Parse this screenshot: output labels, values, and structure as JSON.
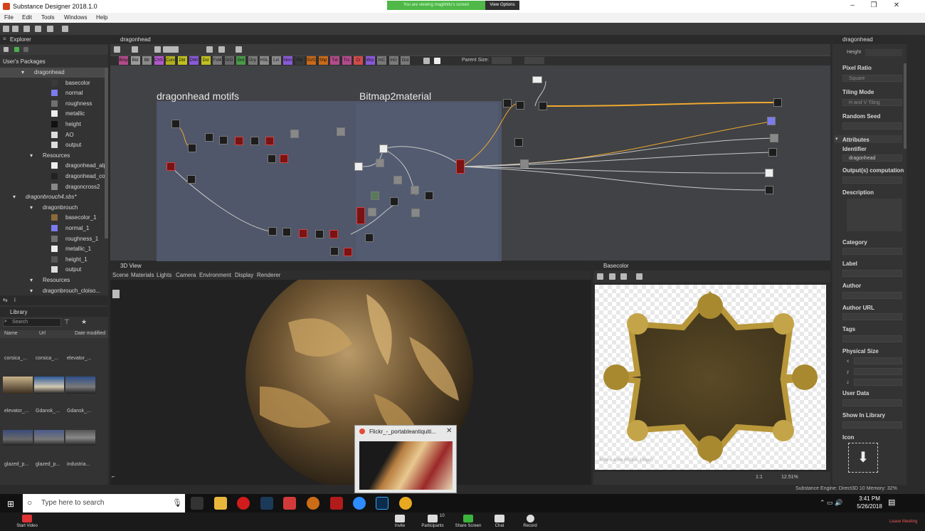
{
  "window": {
    "title": "Substance Designer 2018.1.0",
    "share_banner": "You are viewing magbhitu's screen",
    "view_options": "View Options"
  },
  "menu": [
    "File",
    "Edit",
    "Tools",
    "Windows",
    "Help"
  ],
  "explorer": {
    "title": "Explorer",
    "user_packages": "User's Packages",
    "items": [
      {
        "label": "dragonhead",
        "indent": 1,
        "swatch": "",
        "sel": true
      },
      {
        "label": "basecolor",
        "indent": 3,
        "swatch": "#3a3a3a"
      },
      {
        "label": "normal",
        "indent": 3,
        "swatch": "#7b7bee"
      },
      {
        "label": "roughness",
        "indent": 3,
        "swatch": "#707070"
      },
      {
        "label": "metallic",
        "indent": 3,
        "swatch": "#eeeeee"
      },
      {
        "label": "height",
        "indent": 3,
        "swatch": "#111111"
      },
      {
        "label": "AO",
        "indent": 3,
        "swatch": "#dddddd"
      },
      {
        "label": "output",
        "indent": 3,
        "swatch": "#dddddd"
      },
      {
        "label": "Resources",
        "indent": 2,
        "swatch": ""
      },
      {
        "label": "dragonhead_alpha...",
        "indent": 3,
        "swatch": "#eeeeee"
      },
      {
        "label": "dragonhead_color1",
        "indent": 3,
        "swatch": "#222222"
      },
      {
        "label": "dragoncross2",
        "indent": 3,
        "swatch": "#888888"
      },
      {
        "label": "dragonbrouch4.sbs*",
        "indent": 0,
        "swatch": ""
      },
      {
        "label": "dragonbrouch",
        "indent": 2,
        "swatch": ""
      },
      {
        "label": "basecolor_1",
        "indent": 3,
        "swatch": "#8a6a3a"
      },
      {
        "label": "normal_1",
        "indent": 3,
        "swatch": "#7b7bee"
      },
      {
        "label": "roughness_1",
        "indent": 3,
        "swatch": "#707070"
      },
      {
        "label": "metallic_1",
        "indent": 3,
        "swatch": "#eeeeee"
      },
      {
        "label": "height_1",
        "indent": 3,
        "swatch": "#555555"
      },
      {
        "label": "output",
        "indent": 3,
        "swatch": "#dddddd"
      },
      {
        "label": "Resources",
        "indent": 2,
        "swatch": ""
      },
      {
        "label": "dragonbrouch_cloiso...",
        "indent": 2,
        "swatch": ""
      }
    ]
  },
  "graph": {
    "title": "dragonhead",
    "frame_title": "dragonhead motifs",
    "bitmap_label": "Bitmap2material",
    "parent_size": "Parent Size:",
    "tags": [
      "Bmp",
      "Bld",
      "Blr",
      "ChS",
      "Curv",
      "Dbl",
      "DWr",
      "Dst",
      "FxM",
      "GrD",
      "Grd",
      "Gry",
      "HSL",
      "Lvl",
      "Nrm",
      "Pix",
      "SVG",
      "Shp",
      "Txt",
      "Trs",
      "Cr",
      "Wrp",
      "InC",
      "InG",
      "Out"
    ]
  },
  "view3d": {
    "title": "3D View",
    "menu": [
      "Scene",
      "Materials",
      "Lights",
      "Camera",
      "Environment",
      "Display",
      "Renderer"
    ]
  },
  "basecolor": {
    "title": "Basecolor",
    "info": "4096 x 4096 (RGBA, 16bpc)",
    "zoom": "12.51%",
    "ratio": "1:1"
  },
  "library": {
    "title": "Library",
    "search": "Search",
    "columns": [
      "Name",
      "Url",
      "Date modified"
    ],
    "rows": [
      [
        "corsica_...",
        "corsica_...",
        "elevator_..."
      ],
      [
        "elevator_...",
        "Gdansk_...",
        "Gdansk_..."
      ],
      [
        "glazed_p...",
        "glazed_p...",
        "industria..."
      ]
    ]
  },
  "popup": {
    "title": "Flickr_-_portableantiquiti..."
  },
  "properties": {
    "title": "dragonhead",
    "fields": [
      {
        "label": "Height",
        "value": ""
      },
      {
        "label": "Pixel Ratio",
        "value": "Square"
      },
      {
        "label": "Tiling Mode",
        "value": "H and V Tiling"
      },
      {
        "label": "Random Seed",
        "value": ""
      },
      {
        "label": "Attributes",
        "value": ""
      },
      {
        "label": "Identifier",
        "value": "dragonhead"
      },
      {
        "label": "Output(s) computation",
        "value": ""
      },
      {
        "label": "Description",
        "value": ""
      },
      {
        "label": "Category",
        "value": ""
      },
      {
        "label": "Label",
        "value": ""
      },
      {
        "label": "Author",
        "value": ""
      },
      {
        "label": "Author URL",
        "value": ""
      },
      {
        "label": "Tags",
        "value": ""
      },
      {
        "label": "Physical Size",
        "value": ""
      },
      {
        "label": "User Data",
        "value": ""
      },
      {
        "label": "Show In Library",
        "value": ""
      },
      {
        "label": "Icon",
        "value": ""
      }
    ]
  },
  "status": {
    "engine": "Substance Engine: Direct3D 10  Memory: 32%"
  },
  "taskbar": {
    "search": "Type here to search",
    "time": "3:41 PM",
    "date": "5/26/2018"
  },
  "zoom": {
    "start_video": "Start Video",
    "items": [
      "Invite",
      "Participants",
      "Share Screen",
      "Chat",
      "Record"
    ],
    "participants_count": "10",
    "leave": "Leave Meeting"
  }
}
